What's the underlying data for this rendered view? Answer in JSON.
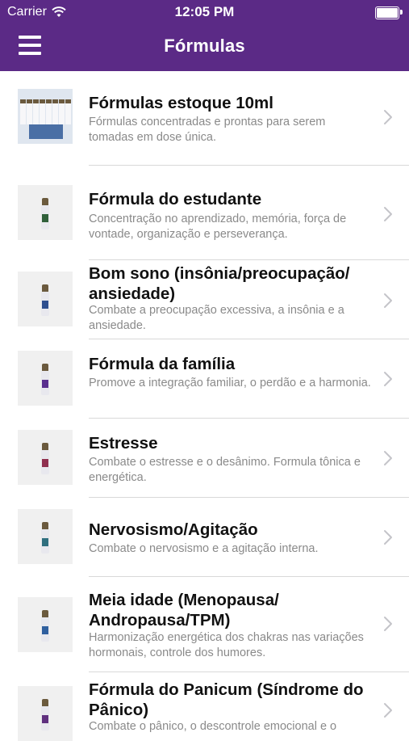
{
  "status_bar": {
    "carrier": "Carrier",
    "time": "12:05 PM"
  },
  "nav": {
    "title": "Fórmulas",
    "menu_icon": "hamburger-menu-icon"
  },
  "items": [
    {
      "title": "Fórmulas estoque 10ml",
      "subtitle": "Fórmulas concentradas e prontas para serem tomadas em dose única.",
      "thumb": "estoque",
      "label_color": "#4a6fa5"
    },
    {
      "title": "Fórmula do estudante",
      "subtitle": "Concentração no aprendizado, memória, força de vontade, organização e perseverança.",
      "thumb": "bottle",
      "label_color": "#2f5f3a"
    },
    {
      "title": "Bom sono (insônia/preocupação/ ansiedade)",
      "subtitle": "Combate a preocupação excessiva, a insônia e a ansiedade.",
      "thumb": "bottle",
      "label_color": "#2f4f8f"
    },
    {
      "title": "Fórmula da família",
      "subtitle": "Promove a integração familiar, o perdão e a harmonia.",
      "thumb": "bottle",
      "label_color": "#5a2f8f"
    },
    {
      "title": "Estresse",
      "subtitle": "Combate o estresse e o desânimo. Formula tônica e energética.",
      "thumb": "bottle",
      "label_color": "#8f2f4f"
    },
    {
      "title": "Nervosismo/Agitação",
      "subtitle": "Combate o nervosismo e a agitação interna.",
      "thumb": "bottle",
      "label_color": "#2f6f7f"
    },
    {
      "title": "Meia idade (Menopausa/ Andropausa/TPM)",
      "subtitle": "Harmonização energética dos chakras nas variações hormonais, controle dos humores.",
      "thumb": "bottle",
      "label_color": "#2f5f9f"
    },
    {
      "title": "Fórmula do Panicum (Síndrome do Pânico)",
      "subtitle": "Combate o pânico, o descontrole emocional e o",
      "thumb": "bottle",
      "label_color": "#5f2f7f"
    }
  ]
}
